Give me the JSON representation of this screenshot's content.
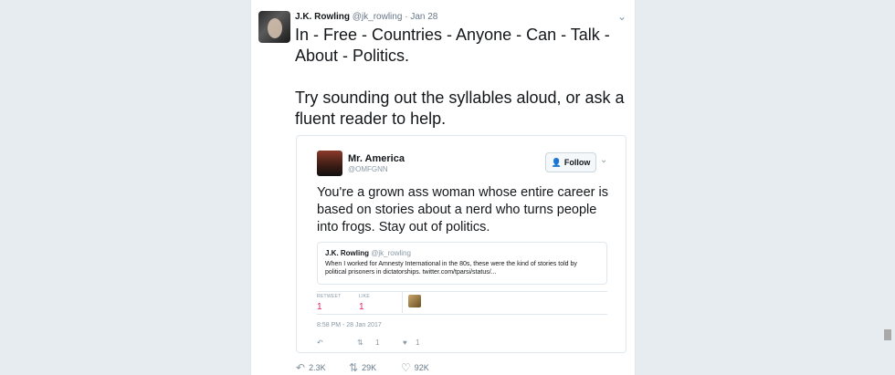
{
  "tweet": {
    "author_name": "J.K. Rowling",
    "author_handle": "@jk_rowling",
    "separator": "·",
    "date": "Jan 28",
    "text_line1": "In - Free - Countries - Anyone - Can - Talk - About - Politics.",
    "text_line2": "Try sounding out the syllables aloud, or ask a fluent reader to help.",
    "actions": {
      "reply_count": "",
      "retweet_count": "2.3K",
      "retweet_count_2": "29K",
      "like_count": "92K"
    }
  },
  "quoted": {
    "author_name": "Mr. America",
    "author_handle": "@OMFGNN",
    "follow_label": "Follow",
    "text": "You're a grown ass woman whose entire career is based on stories about a nerd who turns people into frogs. Stay out of politics.",
    "inner": {
      "author_name": "J.K. Rowling",
      "author_handle": "@jk_rowling",
      "text": "When I worked for Amnesty International in the 80s, these were the kind of stories told by political prisoners in dictatorships. twitter.com/tparsi/status/..."
    },
    "stats": {
      "retweet_label": "RETWEET",
      "retweet_value": "1",
      "like_label": "LIKE",
      "like_value": "1"
    },
    "timestamp": "8:58 PM - 28 Jan 2017",
    "actions": {
      "retweet_count": "1",
      "like_count": "1"
    }
  },
  "icons": {
    "reply": "reply-icon",
    "retweet": "retweet-icon",
    "like": "heart-icon",
    "follow": "follow-user-icon",
    "chevron": "chevron-down-icon"
  },
  "colors": {
    "accent": "#1da1f2",
    "like": "#e0245e",
    "muted": "#657786",
    "background": "#e6ecf0"
  }
}
